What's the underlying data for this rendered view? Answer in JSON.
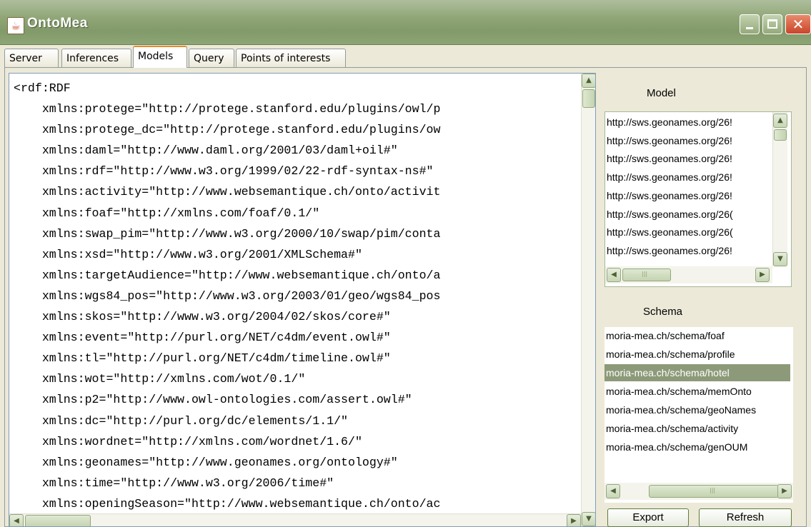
{
  "window": {
    "title": "OntoMea",
    "icon": "java-cup-icon"
  },
  "tabs": [
    {
      "label": "Server"
    },
    {
      "label": "Inferences"
    },
    {
      "label": "Models",
      "active": true
    },
    {
      "label": "Query"
    },
    {
      "label": "Points of interests"
    }
  ],
  "editor": {
    "lines": [
      "<rdf:RDF",
      "    xmlns:protege=\"http://protege.stanford.edu/plugins/owl/p",
      "    xmlns:protege_dc=\"http://protege.stanford.edu/plugins/ow",
      "    xmlns:daml=\"http://www.daml.org/2001/03/daml+oil#\"",
      "    xmlns:rdf=\"http://www.w3.org/1999/02/22-rdf-syntax-ns#\"",
      "    xmlns:activity=\"http://www.websemantique.ch/onto/activit",
      "    xmlns:foaf=\"http://xmlns.com/foaf/0.1/\"",
      "    xmlns:swap_pim=\"http://www.w3.org/2000/10/swap/pim/conta",
      "    xmlns:xsd=\"http://www.w3.org/2001/XMLSchema#\"",
      "    xmlns:targetAudience=\"http://www.websemantique.ch/onto/a",
      "    xmlns:wgs84_pos=\"http://www.w3.org/2003/01/geo/wgs84_pos",
      "    xmlns:skos=\"http://www.w3.org/2004/02/skos/core#\"",
      "    xmlns:event=\"http://purl.org/NET/c4dm/event.owl#\"",
      "    xmlns:tl=\"http://purl.org/NET/c4dm/timeline.owl#\"",
      "    xmlns:wot=\"http://xmlns.com/wot/0.1/\"",
      "    xmlns:p2=\"http://www.owl-ontologies.com/assert.owl#\"",
      "    xmlns:dc=\"http://purl.org/dc/elements/1.1/\"",
      "    xmlns:wordnet=\"http://xmlns.com/wordnet/1.6/\"",
      "    xmlns:geonames=\"http://www.geonames.org/ontology#\"",
      "    xmlns:time=\"http://www.w3.org/2006/time#\"",
      "    xmlns:openingSeason=\"http://www.websemantique.ch/onto/ac"
    ]
  },
  "model_panel": {
    "label": "Model",
    "items": [
      "http://sws.geonames.org/26!",
      "http://sws.geonames.org/26!",
      "http://sws.geonames.org/26!",
      "http://sws.geonames.org/26!",
      "http://sws.geonames.org/26!",
      "http://sws.geonames.org/26(",
      "http://sws.geonames.org/26(",
      "http://sws.geonames.org/26!"
    ]
  },
  "schema_panel": {
    "label": "Schema",
    "items": [
      "moria-mea.ch/schema/foaf",
      "moria-mea.ch/schema/profile",
      "moria-mea.ch/schema/hotel",
      "moria-mea.ch/schema/memOnto",
      "moria-mea.ch/schema/geoNames",
      "moria-mea.ch/schema/activity",
      "moria-mea.ch/schema/genOUM"
    ],
    "selected_index": 2
  },
  "buttons": {
    "export": "Export",
    "refresh": "Refresh"
  },
  "scroll_glyphs": {
    "up": "▲",
    "down": "▼",
    "left": "◀",
    "right": "▶",
    "grip": "|||"
  },
  "colors": {
    "title_bar": "#90a677",
    "selection": "#8d9a79",
    "active_tab_accent": "#e68b2c"
  }
}
